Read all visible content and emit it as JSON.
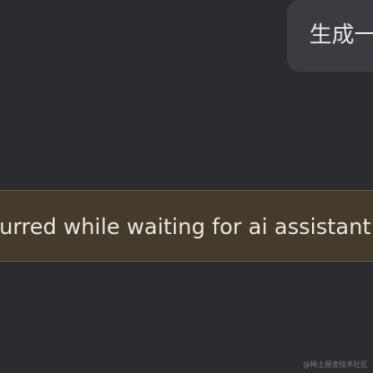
{
  "chat": {
    "user_message": "生成一",
    "error_message": "occurred while waiting for ai assistant\""
  },
  "watermark": "@稀土掘金技术社区",
  "colors": {
    "background": "#2b2c30",
    "user_bubble": "#3b3c42",
    "error_banner": "#443b2c",
    "error_border": "#6b5b3b",
    "text": "#e6e6e6"
  }
}
